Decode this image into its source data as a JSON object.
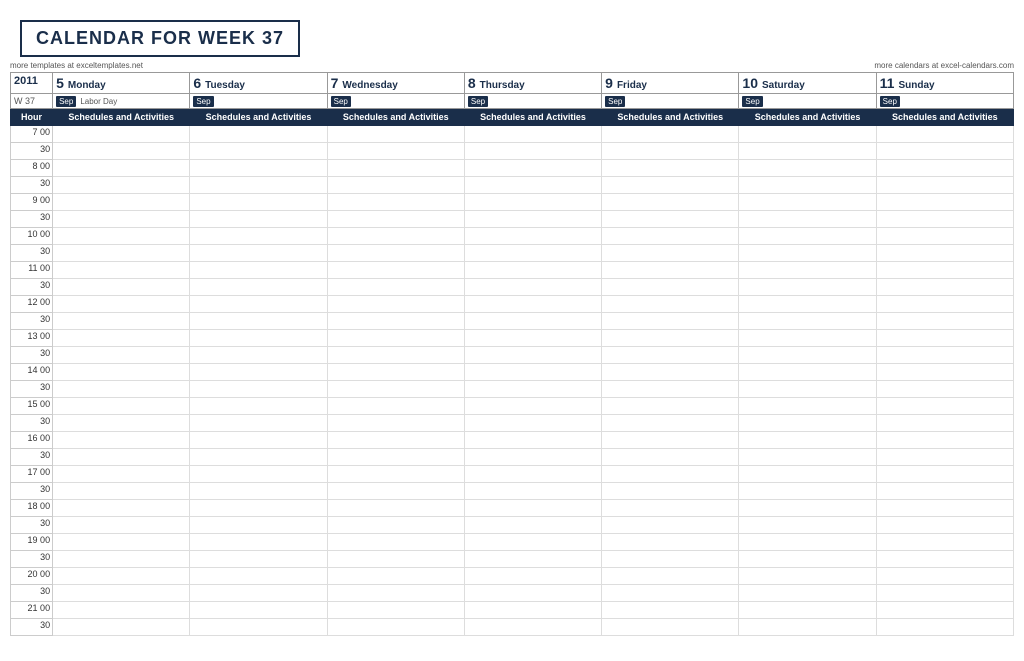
{
  "title": "CALENDAR FOR WEEK 37",
  "subtitle_left": "more templates at exceltemplates.net",
  "subtitle_right": "more calendars at excel-calendars.com",
  "year": "2011",
  "week": "W 37",
  "days": [
    {
      "num": "5",
      "name": "Monday",
      "month": "Sep",
      "event": "Labor Day"
    },
    {
      "num": "6",
      "name": "Tuesday",
      "month": "Sep",
      "event": ""
    },
    {
      "num": "7",
      "name": "Wednesday",
      "month": "Sep",
      "event": ""
    },
    {
      "num": "8",
      "name": "Thursday",
      "month": "Sep",
      "event": ""
    },
    {
      "num": "9",
      "name": "Friday",
      "month": "Sep",
      "event": ""
    },
    {
      "num": "10",
      "name": "Saturday",
      "month": "Sep",
      "event": ""
    },
    {
      "num": "11",
      "name": "Sunday",
      "month": "Sep",
      "event": ""
    }
  ],
  "schedules_label": "Schedules and Activities",
  "hour_label": "Hour",
  "hours": [
    {
      "h": "7",
      "hh": "00"
    },
    {
      "h": "",
      "hh": "30"
    },
    {
      "h": "8",
      "hh": "00"
    },
    {
      "h": "",
      "hh": "30"
    },
    {
      "h": "9",
      "hh": "00"
    },
    {
      "h": "",
      "hh": "30"
    },
    {
      "h": "10",
      "hh": "00"
    },
    {
      "h": "",
      "hh": "30"
    },
    {
      "h": "11",
      "hh": "00"
    },
    {
      "h": "",
      "hh": "30"
    },
    {
      "h": "12",
      "hh": "00"
    },
    {
      "h": "",
      "hh": "30"
    },
    {
      "h": "13",
      "hh": "00"
    },
    {
      "h": "",
      "hh": "30"
    },
    {
      "h": "14",
      "hh": "00"
    },
    {
      "h": "",
      "hh": "30"
    },
    {
      "h": "15",
      "hh": "00"
    },
    {
      "h": "",
      "hh": "30"
    },
    {
      "h": "16",
      "hh": "00"
    },
    {
      "h": "",
      "hh": "30"
    },
    {
      "h": "17",
      "hh": "00"
    },
    {
      "h": "",
      "hh": "30"
    },
    {
      "h": "18",
      "hh": "00"
    },
    {
      "h": "",
      "hh": "30"
    },
    {
      "h": "19",
      "hh": "00"
    },
    {
      "h": "",
      "hh": "30"
    },
    {
      "h": "20",
      "hh": "00"
    },
    {
      "h": "",
      "hh": "30"
    },
    {
      "h": "21",
      "hh": "00"
    },
    {
      "h": "",
      "hh": "30"
    }
  ],
  "colors": {
    "header_bg": "#1a2e4a",
    "header_text": "#ffffff",
    "border": "#aaaaaa",
    "cell_border": "#dddddd"
  }
}
